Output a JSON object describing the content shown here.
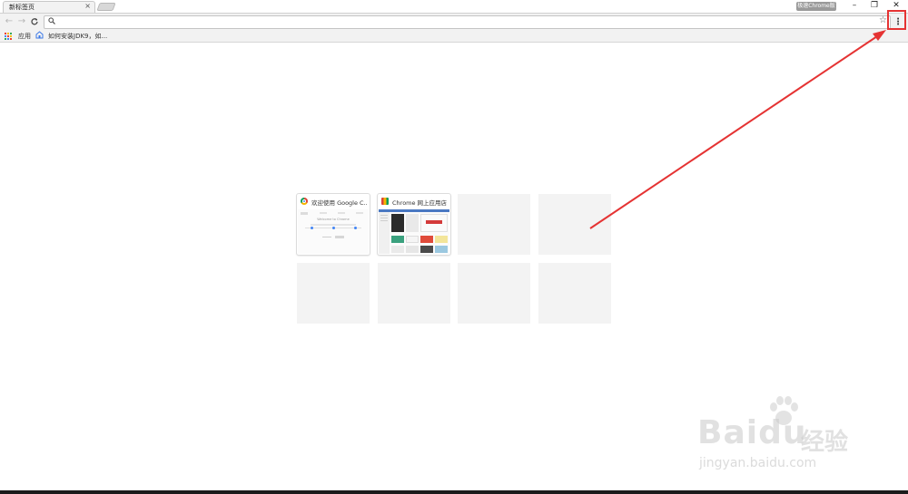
{
  "tab": {
    "title": "新标签页",
    "close": "×"
  },
  "profile": {
    "label": "极速Chrome版"
  },
  "window": {
    "minimize": "–",
    "restore": "❐",
    "close": "✕"
  },
  "toolbar": {
    "back": "←",
    "forward": "→",
    "reload": "C",
    "search_icon": "search-icon",
    "address_value": "",
    "star": "☆",
    "menu": "⋮"
  },
  "bookmarks": {
    "apps_label": "应用",
    "items": [
      {
        "label": "如何安装JDK9，如..."
      }
    ]
  },
  "most_visited": [
    {
      "title": "欢迎使用 Google C...",
      "favicon": "chrome-icon"
    },
    {
      "title": "Chrome 网上应用店",
      "favicon": "webstore-icon"
    }
  ],
  "welcome_preview": {
    "heading": "Welcome to Chrome"
  },
  "watermark": {
    "logo": "Baidu",
    "suffix": "经验",
    "url": "jingyan.baidu.com"
  },
  "colors": {
    "annotation": "#e53333",
    "chrome_bg": "#f2f2f2",
    "tile_empty": "#f3f3f3"
  }
}
